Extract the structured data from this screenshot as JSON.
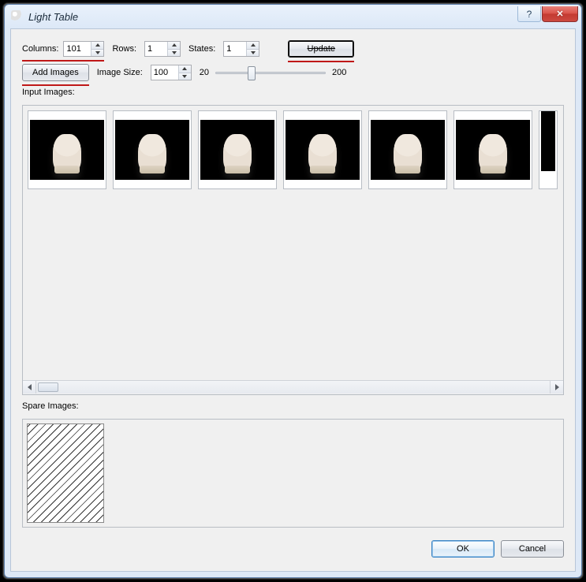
{
  "titlebar": {
    "title": "Light Table"
  },
  "controls": {
    "columns_label": "Columns:",
    "columns_value": "101",
    "rows_label": "Rows:",
    "rows_value": "1",
    "states_label": "States:",
    "states_value": "1",
    "update_label": "Update",
    "add_images_label": "Add Images",
    "image_size_label": "Image Size:",
    "image_size_value": "100",
    "slider_min": "20",
    "slider_max": "200"
  },
  "sections": {
    "input_images_label": "Input Images:",
    "spare_images_label": "Spare Images:"
  },
  "footer": {
    "ok_label": "OK",
    "cancel_label": "Cancel"
  }
}
